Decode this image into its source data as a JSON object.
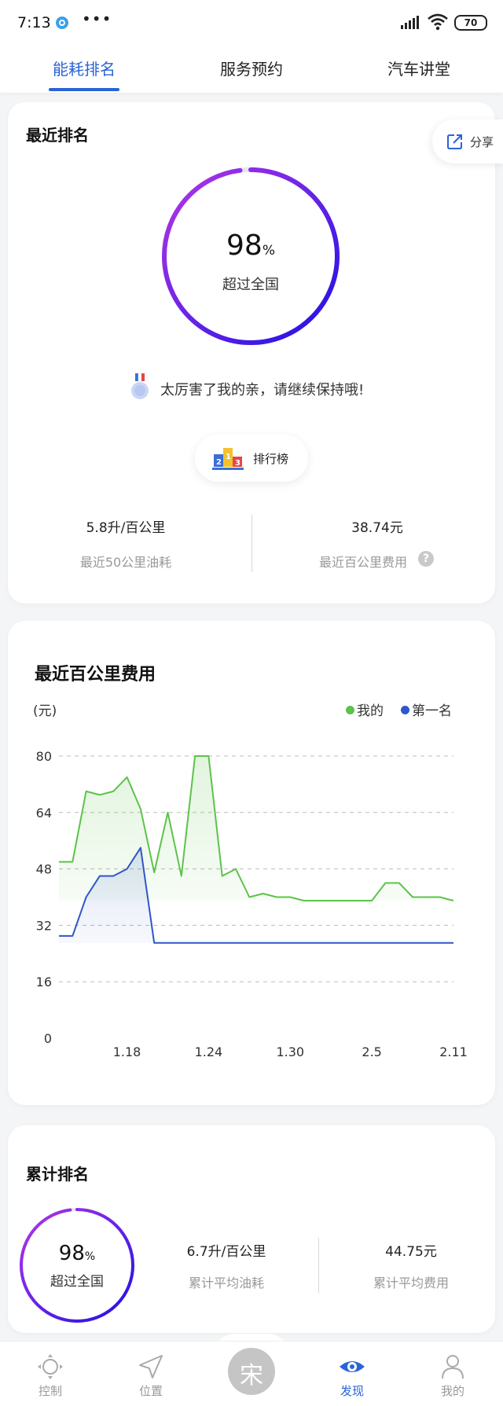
{
  "status_bar": {
    "time": "7:13",
    "more": "•••",
    "battery": "70"
  },
  "top_tabs": [
    {
      "label": "能耗排名",
      "active": true
    },
    {
      "label": "服务预约",
      "active": false
    },
    {
      "label": "汽车讲堂",
      "active": false
    }
  ],
  "share": {
    "label": "分享"
  },
  "recent": {
    "title": "最近排名",
    "percent": "98",
    "percent_unit": "%",
    "caption": "超过全国",
    "praise": "太厉害了我的亲，请继续保持哦!",
    "rank_button": "排行榜",
    "stats": [
      {
        "value": "5.8升/百公里",
        "label": "最近50公里油耗"
      },
      {
        "value": "38.74元",
        "label": "最近百公里费用"
      }
    ],
    "help_icon": "?"
  },
  "chart_card": {
    "title": "最近百公里费用"
  },
  "chart_data": {
    "type": "area",
    "ylabel": "(元)",
    "ylim": [
      0,
      80
    ],
    "yticks": [
      "0",
      "16",
      "32",
      "48",
      "64",
      "80"
    ],
    "xticks": [
      {
        "label": "1.18",
        "x": 5
      },
      {
        "label": "1.24",
        "x": 11
      },
      {
        "label": "1.30",
        "x": 17
      },
      {
        "label": "2.5",
        "x": 23
      },
      {
        "label": "2.11",
        "x": 29
      }
    ],
    "x_range": [
      0,
      29
    ],
    "legend_position": "top-right",
    "grid": "dashed horizontal",
    "series": [
      {
        "name": "我的",
        "color": "#5cc34a",
        "x": [
          0,
          1,
          2,
          3,
          4,
          5,
          6,
          7,
          8,
          9,
          10,
          11,
          12,
          13,
          14,
          15,
          16,
          17,
          18,
          19,
          20,
          21,
          22,
          23,
          24,
          25,
          26,
          27,
          28,
          29
        ],
        "values": [
          50,
          50,
          70,
          69,
          70,
          74,
          65,
          47,
          64,
          46,
          80,
          80,
          46,
          48,
          40,
          41,
          40,
          40,
          39,
          39,
          39,
          39,
          39,
          39,
          44,
          44,
          40,
          40,
          40,
          39
        ]
      },
      {
        "name": "第一名",
        "color": "#2e57c8",
        "x": [
          0,
          1,
          2,
          3,
          4,
          5,
          6,
          7,
          29
        ],
        "values": [
          29,
          29,
          40,
          46,
          46,
          48,
          54,
          27,
          27
        ]
      }
    ]
  },
  "total": {
    "title": "累计排名",
    "percent": "98",
    "percent_unit": "%",
    "caption": "超过全国",
    "stats": [
      {
        "value": "6.7升/百公里",
        "label": "累计平均油耗"
      },
      {
        "value": "44.75元",
        "label": "累计平均费用"
      }
    ]
  },
  "bottom_nav": {
    "items": [
      {
        "label": "控制",
        "active": false
      },
      {
        "label": "位置",
        "active": false
      },
      {
        "label": "发现",
        "active": true
      },
      {
        "label": "我的",
        "active": false
      }
    ],
    "center_glyph": "宋"
  }
}
